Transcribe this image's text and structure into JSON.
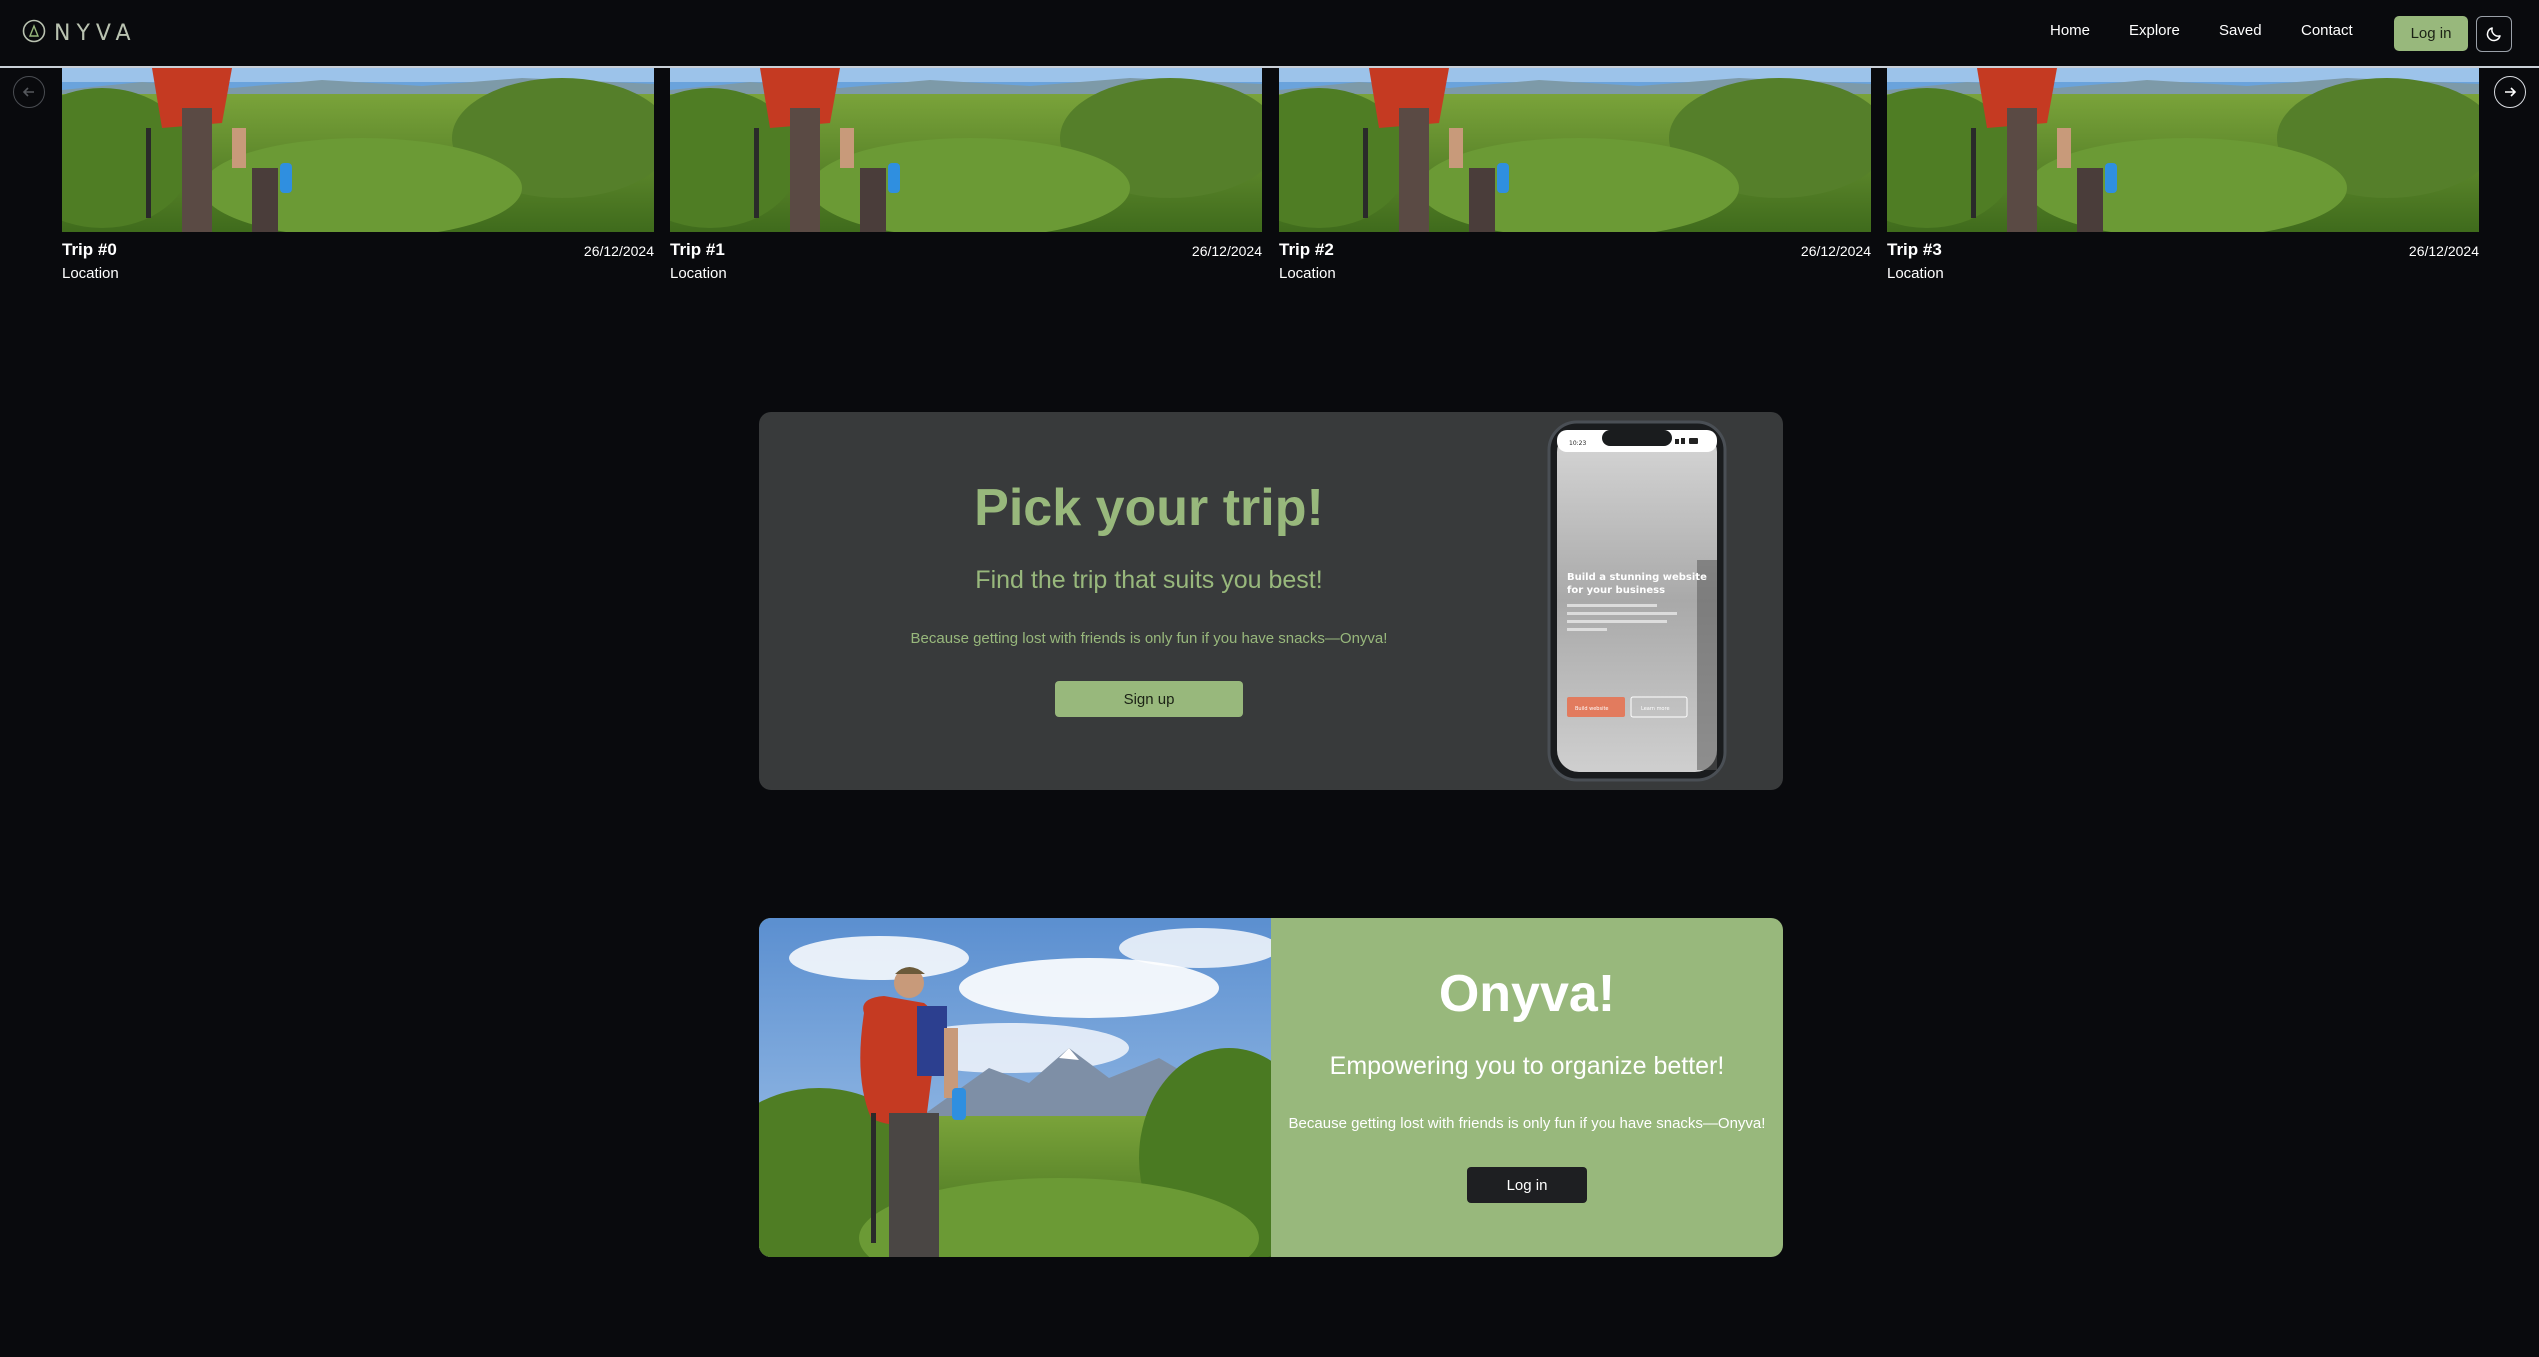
{
  "nav": {
    "logo_text": "NYVA",
    "links": [
      "Home",
      "Explore",
      "Saved",
      "Contact"
    ],
    "login_label": "Log in",
    "theme_icon": "moon-icon"
  },
  "carousel": {
    "prev_icon": "arrow-left-icon",
    "next_icon": "arrow-right-icon",
    "cards": [
      {
        "title": "Trip #0",
        "date": "26/12/2024",
        "location": "Location"
      },
      {
        "title": "Trip #1",
        "date": "26/12/2024",
        "location": "Location"
      },
      {
        "title": "Trip #2",
        "date": "26/12/2024",
        "location": "Location"
      },
      {
        "title": "Trip #3",
        "date": "26/12/2024",
        "location": "Location"
      }
    ]
  },
  "pick": {
    "title": "Pick your trip!",
    "subtitle": "Find the trip that suits you best!",
    "tagline": "Because getting lost with friends is only fun if you have snacks—Onyva!",
    "signup_label": "Sign up",
    "phone": {
      "time": "10:23",
      "headline_1": "Build a stunning website",
      "headline_2": "for your business",
      "btn_primary": "Build website",
      "btn_secondary": "Learn more"
    }
  },
  "onyva": {
    "title": "Onyva!",
    "subtitle": "Empowering you to organize better!",
    "tagline": "Because getting lost with friends is only fun if you have snacks—Onyva!",
    "login_label": "Log in"
  },
  "colors": {
    "accent": "#98b87c",
    "background": "#090a0d",
    "panel": "#383a3b",
    "dark_button": "#1e1f22"
  }
}
